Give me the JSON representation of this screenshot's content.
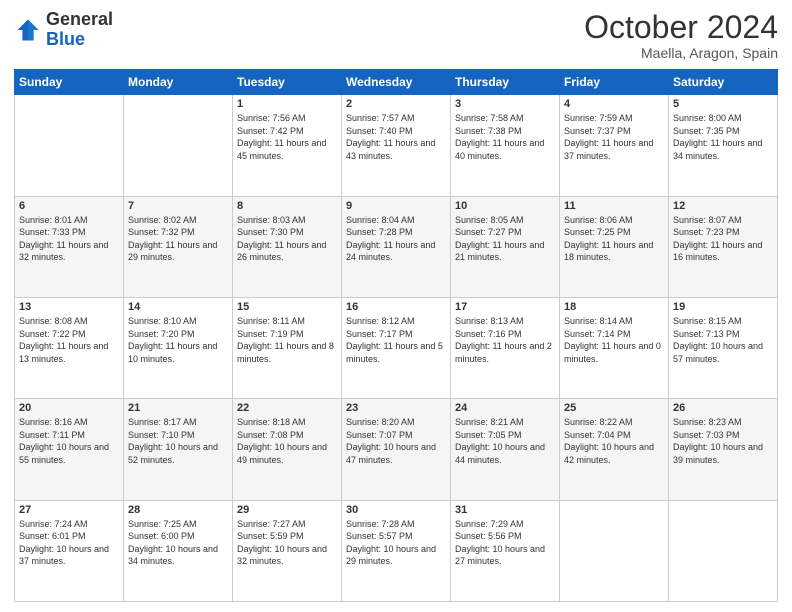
{
  "header": {
    "logo": {
      "general": "General",
      "blue": "Blue"
    },
    "month": "October 2024",
    "location": "Maella, Aragon, Spain"
  },
  "days_of_week": [
    "Sunday",
    "Monday",
    "Tuesday",
    "Wednesday",
    "Thursday",
    "Friday",
    "Saturday"
  ],
  "weeks": [
    [
      null,
      null,
      {
        "day": "1",
        "sunrise": "Sunrise: 7:56 AM",
        "sunset": "Sunset: 7:42 PM",
        "daylight": "Daylight: 11 hours and 45 minutes."
      },
      {
        "day": "2",
        "sunrise": "Sunrise: 7:57 AM",
        "sunset": "Sunset: 7:40 PM",
        "daylight": "Daylight: 11 hours and 43 minutes."
      },
      {
        "day": "3",
        "sunrise": "Sunrise: 7:58 AM",
        "sunset": "Sunset: 7:38 PM",
        "daylight": "Daylight: 11 hours and 40 minutes."
      },
      {
        "day": "4",
        "sunrise": "Sunrise: 7:59 AM",
        "sunset": "Sunset: 7:37 PM",
        "daylight": "Daylight: 11 hours and 37 minutes."
      },
      {
        "day": "5",
        "sunrise": "Sunrise: 8:00 AM",
        "sunset": "Sunset: 7:35 PM",
        "daylight": "Daylight: 11 hours and 34 minutes."
      }
    ],
    [
      {
        "day": "6",
        "sunrise": "Sunrise: 8:01 AM",
        "sunset": "Sunset: 7:33 PM",
        "daylight": "Daylight: 11 hours and 32 minutes."
      },
      {
        "day": "7",
        "sunrise": "Sunrise: 8:02 AM",
        "sunset": "Sunset: 7:32 PM",
        "daylight": "Daylight: 11 hours and 29 minutes."
      },
      {
        "day": "8",
        "sunrise": "Sunrise: 8:03 AM",
        "sunset": "Sunset: 7:30 PM",
        "daylight": "Daylight: 11 hours and 26 minutes."
      },
      {
        "day": "9",
        "sunrise": "Sunrise: 8:04 AM",
        "sunset": "Sunset: 7:28 PM",
        "daylight": "Daylight: 11 hours and 24 minutes."
      },
      {
        "day": "10",
        "sunrise": "Sunrise: 8:05 AM",
        "sunset": "Sunset: 7:27 PM",
        "daylight": "Daylight: 11 hours and 21 minutes."
      },
      {
        "day": "11",
        "sunrise": "Sunrise: 8:06 AM",
        "sunset": "Sunset: 7:25 PM",
        "daylight": "Daylight: 11 hours and 18 minutes."
      },
      {
        "day": "12",
        "sunrise": "Sunrise: 8:07 AM",
        "sunset": "Sunset: 7:23 PM",
        "daylight": "Daylight: 11 hours and 16 minutes."
      }
    ],
    [
      {
        "day": "13",
        "sunrise": "Sunrise: 8:08 AM",
        "sunset": "Sunset: 7:22 PM",
        "daylight": "Daylight: 11 hours and 13 minutes."
      },
      {
        "day": "14",
        "sunrise": "Sunrise: 8:10 AM",
        "sunset": "Sunset: 7:20 PM",
        "daylight": "Daylight: 11 hours and 10 minutes."
      },
      {
        "day": "15",
        "sunrise": "Sunrise: 8:11 AM",
        "sunset": "Sunset: 7:19 PM",
        "daylight": "Daylight: 11 hours and 8 minutes."
      },
      {
        "day": "16",
        "sunrise": "Sunrise: 8:12 AM",
        "sunset": "Sunset: 7:17 PM",
        "daylight": "Daylight: 11 hours and 5 minutes."
      },
      {
        "day": "17",
        "sunrise": "Sunrise: 8:13 AM",
        "sunset": "Sunset: 7:16 PM",
        "daylight": "Daylight: 11 hours and 2 minutes."
      },
      {
        "day": "18",
        "sunrise": "Sunrise: 8:14 AM",
        "sunset": "Sunset: 7:14 PM",
        "daylight": "Daylight: 11 hours and 0 minutes."
      },
      {
        "day": "19",
        "sunrise": "Sunrise: 8:15 AM",
        "sunset": "Sunset: 7:13 PM",
        "daylight": "Daylight: 10 hours and 57 minutes."
      }
    ],
    [
      {
        "day": "20",
        "sunrise": "Sunrise: 8:16 AM",
        "sunset": "Sunset: 7:11 PM",
        "daylight": "Daylight: 10 hours and 55 minutes."
      },
      {
        "day": "21",
        "sunrise": "Sunrise: 8:17 AM",
        "sunset": "Sunset: 7:10 PM",
        "daylight": "Daylight: 10 hours and 52 minutes."
      },
      {
        "day": "22",
        "sunrise": "Sunrise: 8:18 AM",
        "sunset": "Sunset: 7:08 PM",
        "daylight": "Daylight: 10 hours and 49 minutes."
      },
      {
        "day": "23",
        "sunrise": "Sunrise: 8:20 AM",
        "sunset": "Sunset: 7:07 PM",
        "daylight": "Daylight: 10 hours and 47 minutes."
      },
      {
        "day": "24",
        "sunrise": "Sunrise: 8:21 AM",
        "sunset": "Sunset: 7:05 PM",
        "daylight": "Daylight: 10 hours and 44 minutes."
      },
      {
        "day": "25",
        "sunrise": "Sunrise: 8:22 AM",
        "sunset": "Sunset: 7:04 PM",
        "daylight": "Daylight: 10 hours and 42 minutes."
      },
      {
        "day": "26",
        "sunrise": "Sunrise: 8:23 AM",
        "sunset": "Sunset: 7:03 PM",
        "daylight": "Daylight: 10 hours and 39 minutes."
      }
    ],
    [
      {
        "day": "27",
        "sunrise": "Sunrise: 7:24 AM",
        "sunset": "Sunset: 6:01 PM",
        "daylight": "Daylight: 10 hours and 37 minutes."
      },
      {
        "day": "28",
        "sunrise": "Sunrise: 7:25 AM",
        "sunset": "Sunset: 6:00 PM",
        "daylight": "Daylight: 10 hours and 34 minutes."
      },
      {
        "day": "29",
        "sunrise": "Sunrise: 7:27 AM",
        "sunset": "Sunset: 5:59 PM",
        "daylight": "Daylight: 10 hours and 32 minutes."
      },
      {
        "day": "30",
        "sunrise": "Sunrise: 7:28 AM",
        "sunset": "Sunset: 5:57 PM",
        "daylight": "Daylight: 10 hours and 29 minutes."
      },
      {
        "day": "31",
        "sunrise": "Sunrise: 7:29 AM",
        "sunset": "Sunset: 5:56 PM",
        "daylight": "Daylight: 10 hours and 27 minutes."
      },
      null,
      null
    ]
  ]
}
